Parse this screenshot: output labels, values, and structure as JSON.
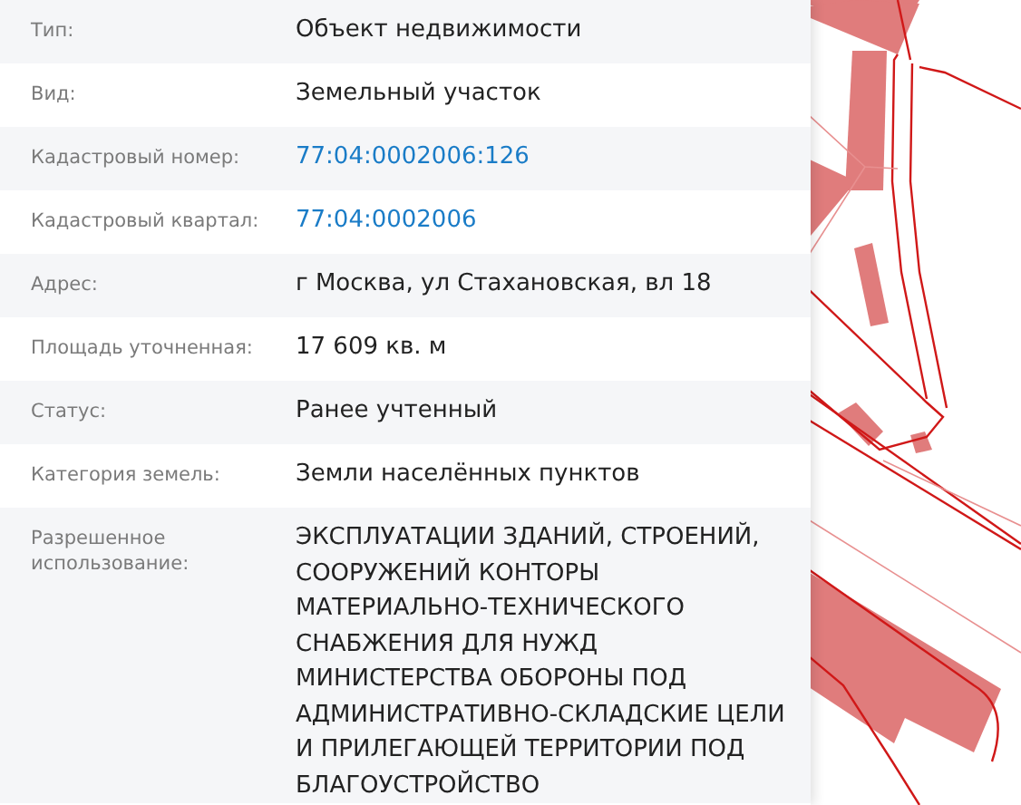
{
  "properties": [
    {
      "label": "Тип:",
      "value": "Объект недвижимости",
      "kind": "text"
    },
    {
      "label": "Вид:",
      "value": "Земельный участок",
      "kind": "text"
    },
    {
      "label": "Кадастровый номер:",
      "value": "77:04:0002006:126",
      "kind": "link"
    },
    {
      "label": "Кадастровый квартал:",
      "value": "77:04:0002006",
      "kind": "link"
    },
    {
      "label": "Адрес:",
      "value": "г Москва, ул Стахановская, вл 18",
      "kind": "text"
    },
    {
      "label": "Площадь уточненная:",
      "value": "17 609 кв. м",
      "kind": "text"
    },
    {
      "label": "Статус:",
      "value": "Ранее учтенный",
      "kind": "text"
    },
    {
      "label": "Категория земель:",
      "value": "Земли населённых пунктов",
      "kind": "text"
    },
    {
      "label": "Разрешенное использование:",
      "value": "ЭКСПЛУАТАЦИИ ЗДАНИЙ, СТРОЕНИЙ, СООРУЖЕНИЙ КОНТОРЫ МАТЕРИАЛЬНО-ТЕХНИЧЕСКОГО СНАБЖЕНИЯ ДЛЯ НУЖД МИНИСТЕРСТВА ОБОРОНЫ ПОД АДМИНИСТРАТИВНО-СКЛАДСКИЕ ЦЕЛИ И ПРИЛЕГАЮЩЕЙ ТЕРРИТОРИИ ПОД БЛАГОУСТРОЙСТВО",
      "kind": "text"
    }
  ]
}
